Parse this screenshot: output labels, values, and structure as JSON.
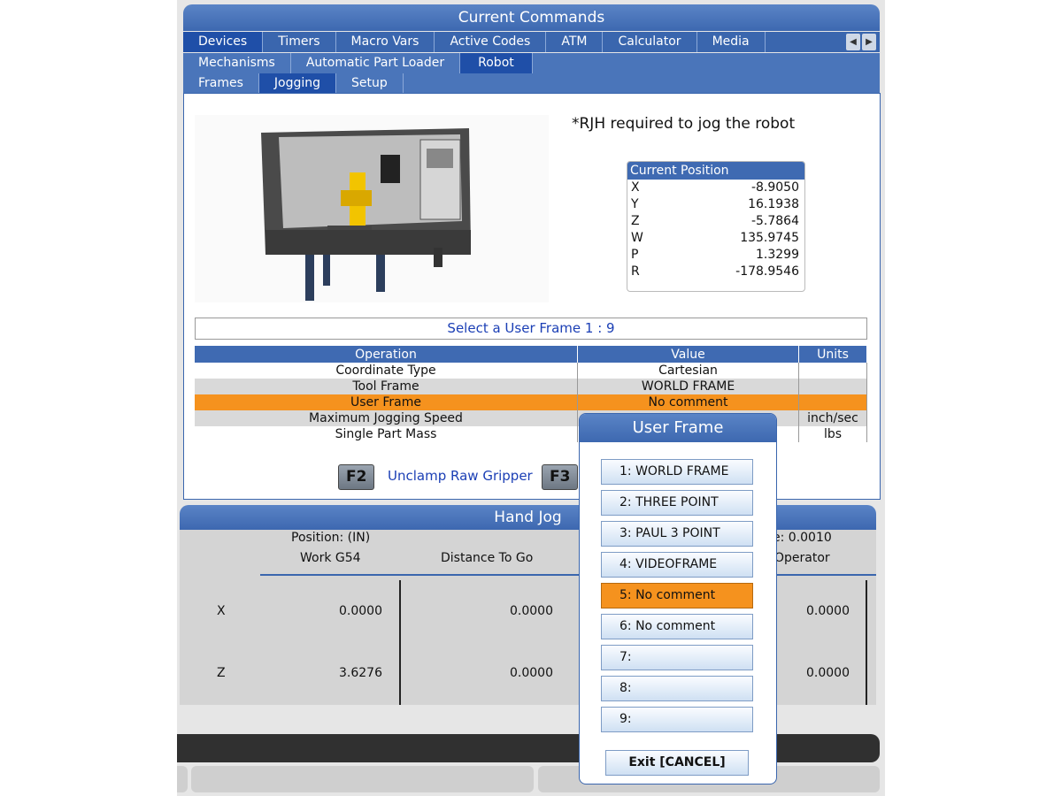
{
  "header": {
    "title": "Current Commands"
  },
  "tabs_row1": [
    "Devices",
    "Timers",
    "Macro Vars",
    "Active Codes",
    "ATM",
    "Calculator",
    "Media"
  ],
  "tabs_row2": [
    "Mechanisms",
    "Automatic Part Loader",
    "Robot"
  ],
  "tabs_row3": [
    "Frames",
    "Jogging",
    "Setup"
  ],
  "jogging": {
    "rjh_note": "*RJH required to jog the robot",
    "current_position": {
      "title": "Current Position",
      "rows": [
        {
          "axis": "X",
          "value": "-8.9050"
        },
        {
          "axis": "Y",
          "value": "16.1938"
        },
        {
          "axis": "Z",
          "value": "-5.7864"
        },
        {
          "axis": "W",
          "value": "135.9745"
        },
        {
          "axis": "P",
          "value": "1.3299"
        },
        {
          "axis": "R",
          "value": "-178.9546"
        }
      ]
    },
    "select_frame_prompt": "Select a User Frame 1 : 9",
    "table": {
      "headers": [
        "Operation",
        "Value",
        "Units"
      ],
      "rows": [
        {
          "operation": "Coordinate Type",
          "value": "Cartesian",
          "units": ""
        },
        {
          "operation": "Tool Frame",
          "value": "WORLD FRAME",
          "units": ""
        },
        {
          "operation": "User Frame",
          "value": "No comment",
          "units": ""
        },
        {
          "operation": "Maximum Jogging Speed",
          "value": "",
          "units": "inch/sec"
        },
        {
          "operation": "Single Part Mass",
          "value": "",
          "units": "lbs"
        }
      ]
    },
    "f2_key": "F2",
    "f2_label": "Unclamp Raw Gripper",
    "f3_key": "F3"
  },
  "hand_jog": {
    "title": "Hand Jog",
    "position_label": "Position: (IN)",
    "increment_partial": "e: 0.0010",
    "col_work": "Work G54",
    "col_dtg": "Distance To Go",
    "col_operator_partial": "Operator",
    "rows": [
      {
        "axis": "X",
        "work": "0.0000",
        "dtg": "0.0000",
        "operator": "0.0000"
      },
      {
        "axis": "Z",
        "work": "3.6276",
        "dtg": "0.0000",
        "operator": "0.0000"
      }
    ]
  },
  "dialog": {
    "title": "User Frame",
    "options": [
      "1: WORLD FRAME",
      "2: THREE POINT",
      "3: PAUL 3 POINT",
      "4: VIDEOFRAME",
      "5: No comment",
      "6: No comment",
      "7:",
      "8:",
      "9:"
    ],
    "selected_index": 4,
    "exit_label": "Exit [CANCEL]"
  },
  "colors": {
    "accent": "#3a66ae",
    "highlight": "#f5921e",
    "link": "#1b3fb5"
  },
  "icons": [
    "arrow-left-icon",
    "arrow-right-icon",
    "robot-lathe-image"
  ]
}
